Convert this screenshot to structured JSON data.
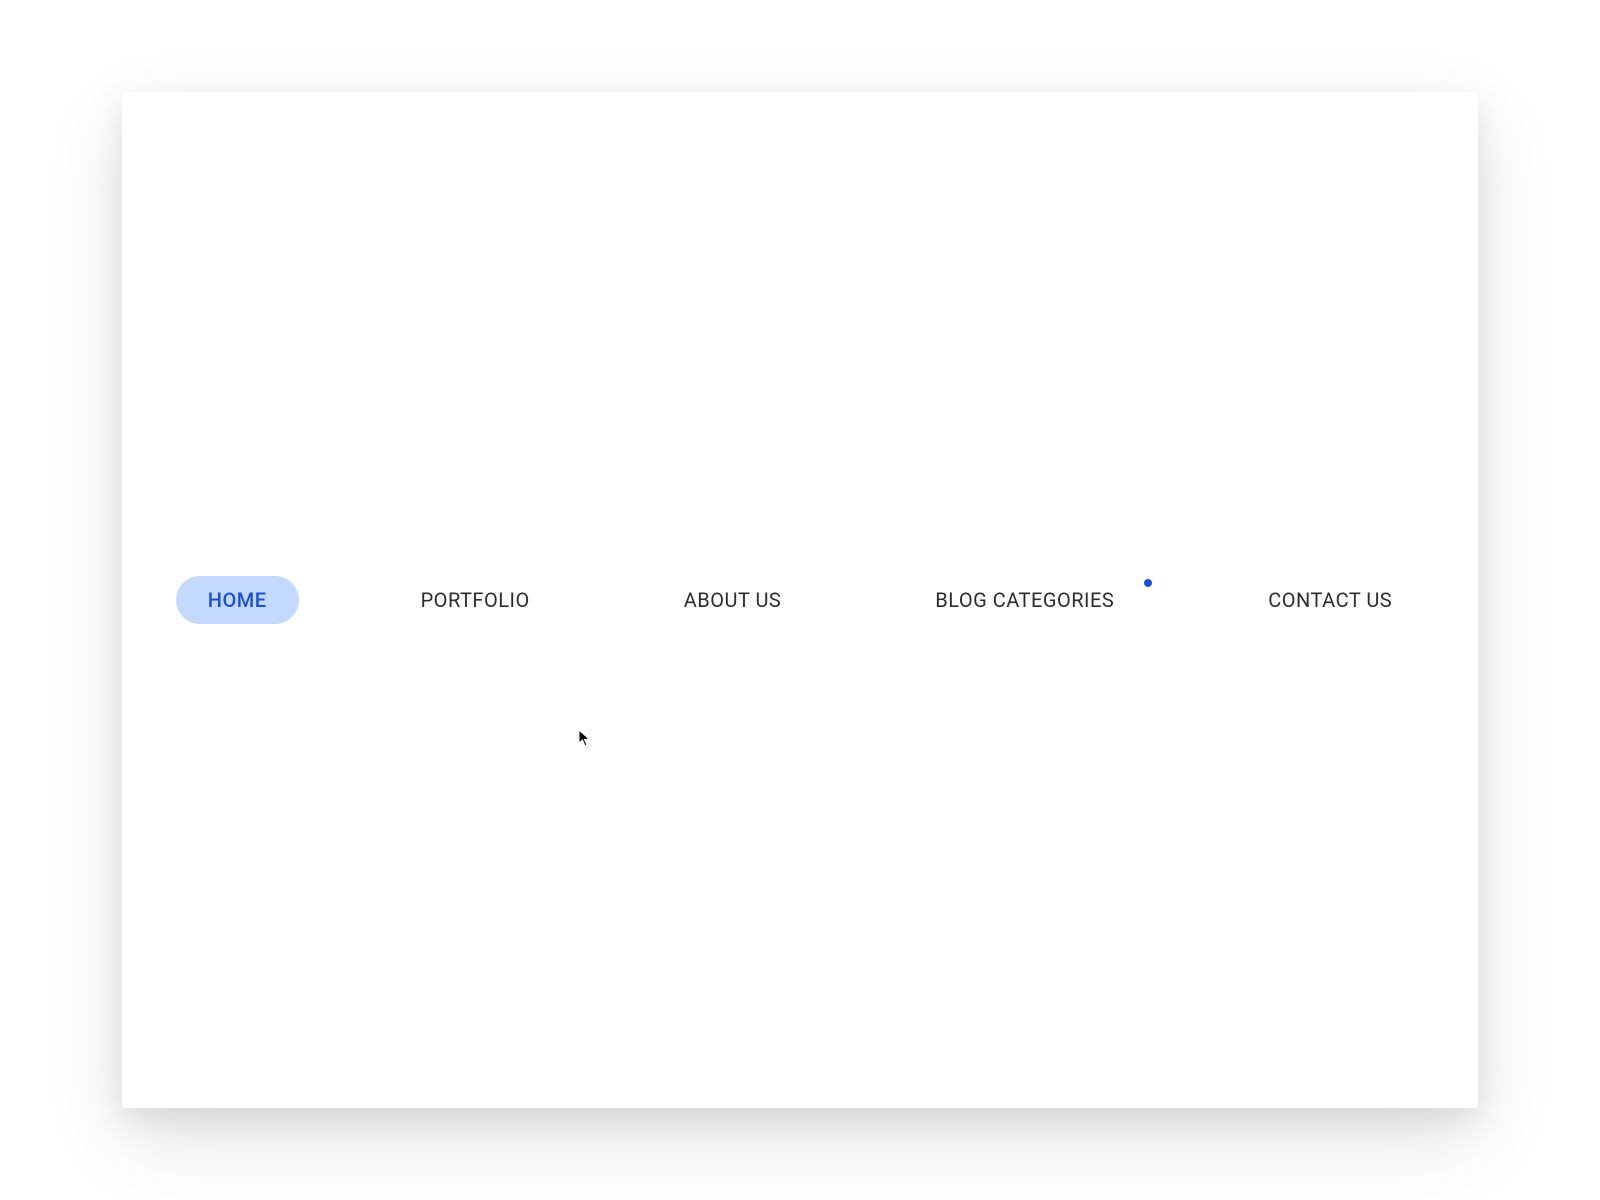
{
  "nav": {
    "items": [
      {
        "label": "HOME",
        "id": "home",
        "active": true,
        "badge": false
      },
      {
        "label": "PORTFOLIO",
        "id": "portfolio",
        "active": false,
        "badge": false
      },
      {
        "label": "ABOUT US",
        "id": "about-us",
        "active": false,
        "badge": false
      },
      {
        "label": "BLOG CATEGORIES",
        "id": "blog-categories",
        "active": false,
        "badge": true
      },
      {
        "label": "CONTACT US",
        "id": "contact-us",
        "active": false,
        "badge": false
      }
    ]
  },
  "colors": {
    "active_bg": "#c3d9ff",
    "active_text": "#1a4fd6",
    "text": "#2c2c2c",
    "badge": "#1a4fd6"
  }
}
